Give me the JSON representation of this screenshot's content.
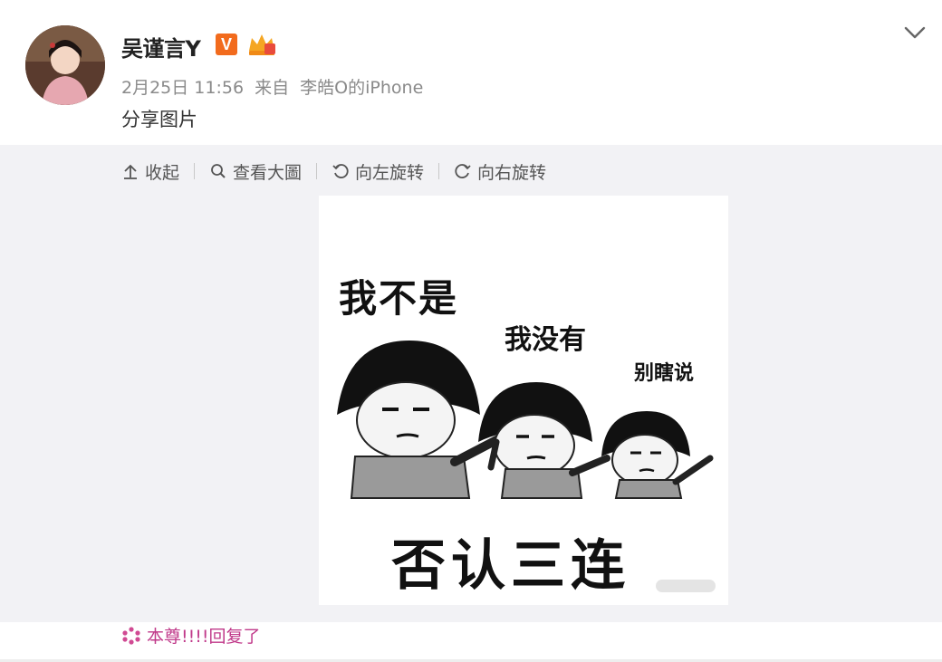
{
  "post": {
    "username": "吴谨言Y",
    "vip_badge": "V",
    "timestamp": "2月25日 11:56",
    "source_prefix": "来自",
    "source_device": "李皓O的iPhone",
    "text": "分享图片"
  },
  "toolbar": {
    "collapse": "收起",
    "view_large": "查看大圖",
    "rotate_left": "向左旋转",
    "rotate_right": "向右旋转"
  },
  "image": {
    "caption_1": "我不是",
    "caption_2": "我没有",
    "caption_3": "别瞎说",
    "caption_main": "否认三连"
  },
  "reply": {
    "text": "本尊!!!!回复了"
  },
  "colors": {
    "accent_orange": "#f26b1d",
    "reply_pink": "#c0398a",
    "panel_gray": "#f2f2f5"
  }
}
